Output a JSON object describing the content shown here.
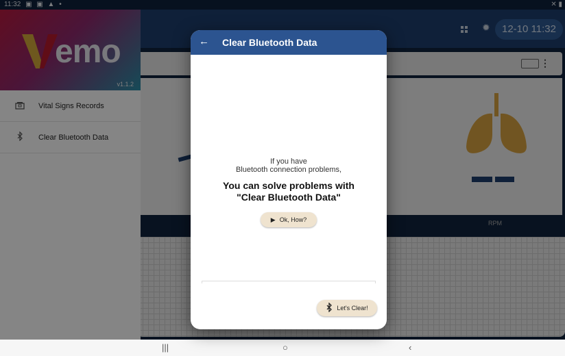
{
  "status_bar": {
    "time": "11:32",
    "icons": "▣ ▣ ▲ •",
    "right_icons": "✕ ▮"
  },
  "app_bar": {
    "clock": "12-10 11:32",
    "grid_icon": "grid-icon",
    "settings_icon": "gear-icon"
  },
  "drawer": {
    "logo_v": "V",
    "logo_text": "emo",
    "version": "v1.1.2",
    "items": [
      {
        "label": "Vital Signs Records",
        "icon": "records-icon",
        "glyph": "🗂"
      },
      {
        "label": "Clear Bluetooth Data",
        "icon": "bluetooth-icon",
        "glyph": "∦"
      }
    ]
  },
  "background": {
    "rpm_label": "RPM"
  },
  "dialog": {
    "back_glyph": "←",
    "title": "Clear Bluetooth Data",
    "line1": "If you have",
    "line2": "Bluetooth connection problems,",
    "line3": "You can solve problems with",
    "line4": "\"Clear Bluetooth Data\"",
    "ok_label": "Ok, How?",
    "play_glyph": "▶",
    "clear_label": "Let's Clear!",
    "bt_glyph": "∦"
  },
  "nav_bar": {
    "recent": "|||",
    "home": "○",
    "back": "‹"
  },
  "colors": {
    "primary": "#2c5490",
    "app_bar": "#1e3f6e",
    "button_bg": "#efe3cf",
    "lungs": "#d9a441"
  }
}
